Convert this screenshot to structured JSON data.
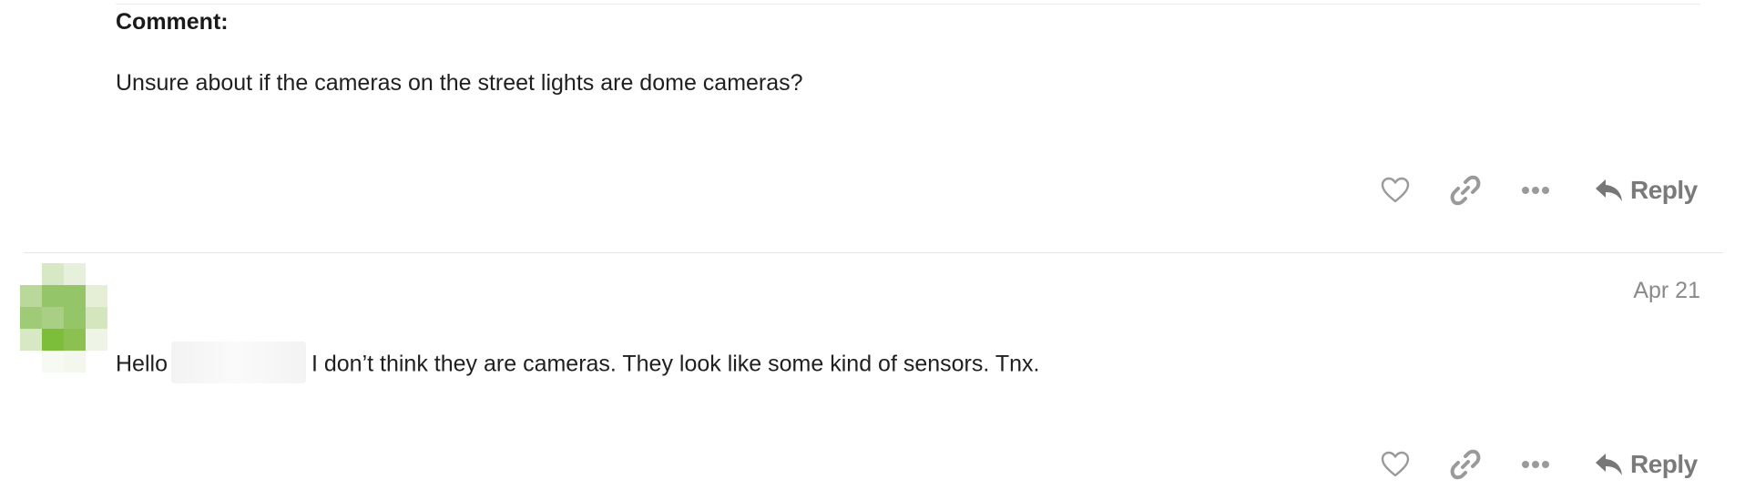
{
  "post1": {
    "label": "Comment:",
    "body": "Unsure about if the cameras on the street lights are dome cameras?",
    "reply_label": "Reply",
    "like_icon": "heart-icon",
    "link_icon": "link-icon",
    "more_icon": "ellipsis-icon",
    "reply_icon": "reply-arrow-icon"
  },
  "post2": {
    "date": "Apr 21",
    "body_start": "Hello",
    "body_rest": "I don’t think they are cameras. They look like some kind of sensors. Tnx.",
    "reply_label": "Reply",
    "avatar_color": "#7cbd3a"
  },
  "colors": {
    "icon_gray": "#9a9a9a",
    "reply_gray": "#7a7a7a",
    "text": "#1f1f1f",
    "muted": "#8a8a8a",
    "divider": "#e6e6e6"
  }
}
